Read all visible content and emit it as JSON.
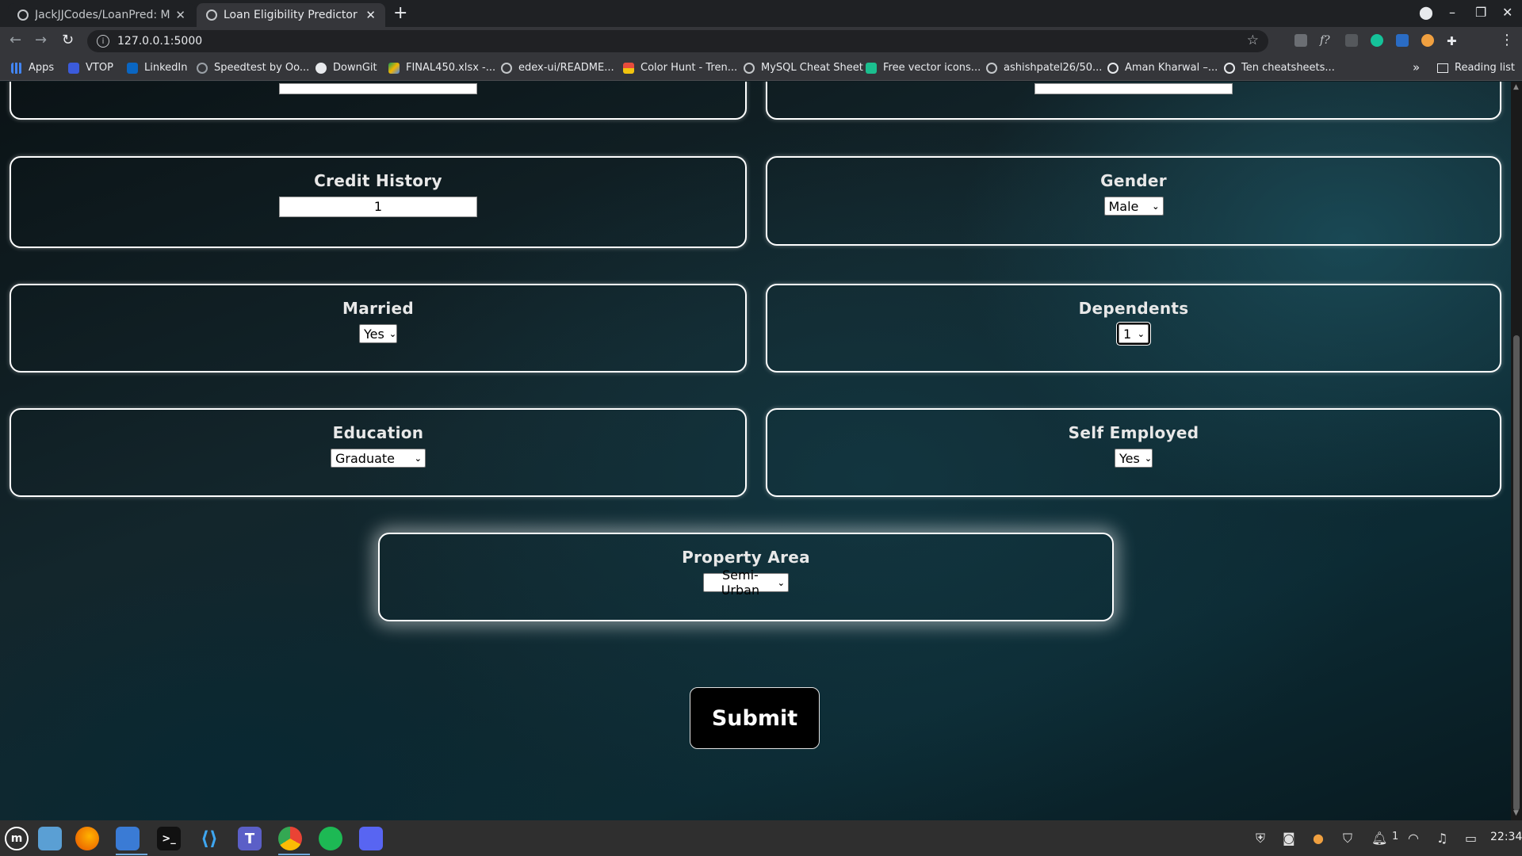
{
  "browser": {
    "tabs": [
      {
        "title": "JackJJCodes/LoanPred: ML-b",
        "active": false
      },
      {
        "title": "Loan Eligibility Predictor",
        "active": true
      }
    ],
    "url": "127.0.0.1:5000",
    "bookmarks": [
      "Apps",
      "VTOP",
      "LinkedIn",
      "Speedtest by Oo...",
      "DownGit",
      "FINAL450.xlsx -...",
      "edex-ui/README...",
      "Color Hunt - Tren...",
      "MySQL Cheat Sheet",
      "Free vector icons...",
      "ashishpatel26/50...",
      "Aman Kharwal –...",
      "Ten cheatsheets..."
    ],
    "reading_list": "Reading list",
    "profile_initial": "J"
  },
  "form": {
    "credit_history": {
      "label": "Credit History",
      "value": "1"
    },
    "gender": {
      "label": "Gender",
      "value": "Male"
    },
    "married": {
      "label": "Married",
      "value": "Yes"
    },
    "dependents": {
      "label": "Dependents",
      "value": "1"
    },
    "education": {
      "label": "Education",
      "value": "Graduate"
    },
    "self_employed": {
      "label": "Self Employed",
      "value": "Yes"
    },
    "property_area": {
      "label": "Property Area",
      "value": "Semi-Urban"
    },
    "submit_label": "Submit"
  },
  "taskbar": {
    "apps": [
      "mint-menu-icon",
      "files-icon",
      "firefox-icon",
      "software-manager-icon",
      "terminal-icon",
      "vscode-icon",
      "teams-icon",
      "chrome-icon",
      "spotify-icon",
      "discord-icon"
    ],
    "notification_count": "1",
    "time": "22:34"
  },
  "colors": {
    "page_bg": "#0e1a1f",
    "card_border": "#ffffff",
    "submit_bg": "#000000"
  }
}
